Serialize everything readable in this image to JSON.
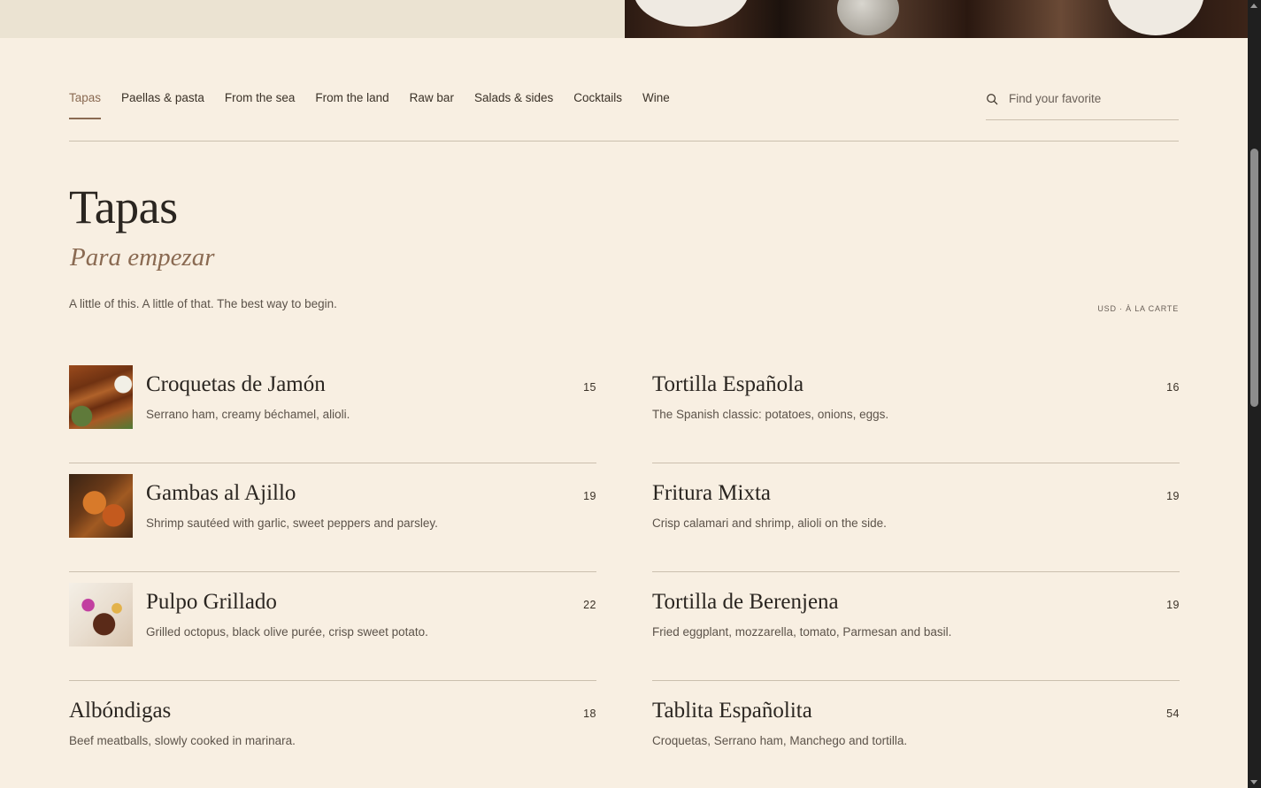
{
  "nav": {
    "tabs": [
      {
        "label": "Tapas",
        "active": true
      },
      {
        "label": "Paellas & pasta"
      },
      {
        "label": "From the sea"
      },
      {
        "label": "From the land"
      },
      {
        "label": "Raw bar"
      },
      {
        "label": "Salads & sides"
      },
      {
        "label": "Cocktails"
      },
      {
        "label": "Wine"
      }
    ],
    "search": {
      "placeholder": "Find your favorite",
      "value": "",
      "icon": "search-icon"
    }
  },
  "section": {
    "title": "Tapas",
    "subtitle": "Para empezar",
    "intro": "A little of this. A little of that. The best way to begin.",
    "currency_note": "USD · À LA CARTE"
  },
  "menu": {
    "left": [
      {
        "name": "Croquetas de Jamón",
        "desc": "Serrano ham, creamy béchamel, alioli.",
        "price": "15",
        "image": "croquetas-photo"
      },
      {
        "name": "Gambas al Ajillo",
        "desc": "Shrimp sautéed with garlic, sweet peppers and parsley.",
        "price": "19",
        "image": "gambas-photo"
      },
      {
        "name": "Pulpo Grillado",
        "desc": "Grilled octopus, black olive purée, crisp sweet potato.",
        "price": "22",
        "image": "pulpo-photo"
      },
      {
        "name": "Albóndigas",
        "desc": "Beef meatballs, slowly cooked in marinara.",
        "price": "18"
      }
    ],
    "right": [
      {
        "name": "Tortilla Española",
        "desc": "The Spanish classic: potatoes, onions, eggs.",
        "price": "16"
      },
      {
        "name": "Fritura Mixta",
        "desc": "Crisp calamari and shrimp, alioli on the side.",
        "price": "19"
      },
      {
        "name": "Tortilla de Berenjena",
        "desc": "Fried eggplant, mozzarella, tomato, Parmesan and basil.",
        "price": "19"
      },
      {
        "name": "Tablita Españolita",
        "desc": "Croquetas, Serrano ham, Manchego and tortilla.",
        "price": "54"
      }
    ]
  },
  "colors": {
    "accent": "#8a6a52",
    "background": "#f8efe2",
    "text": "#2a2520",
    "rule": "#cbbfae"
  }
}
